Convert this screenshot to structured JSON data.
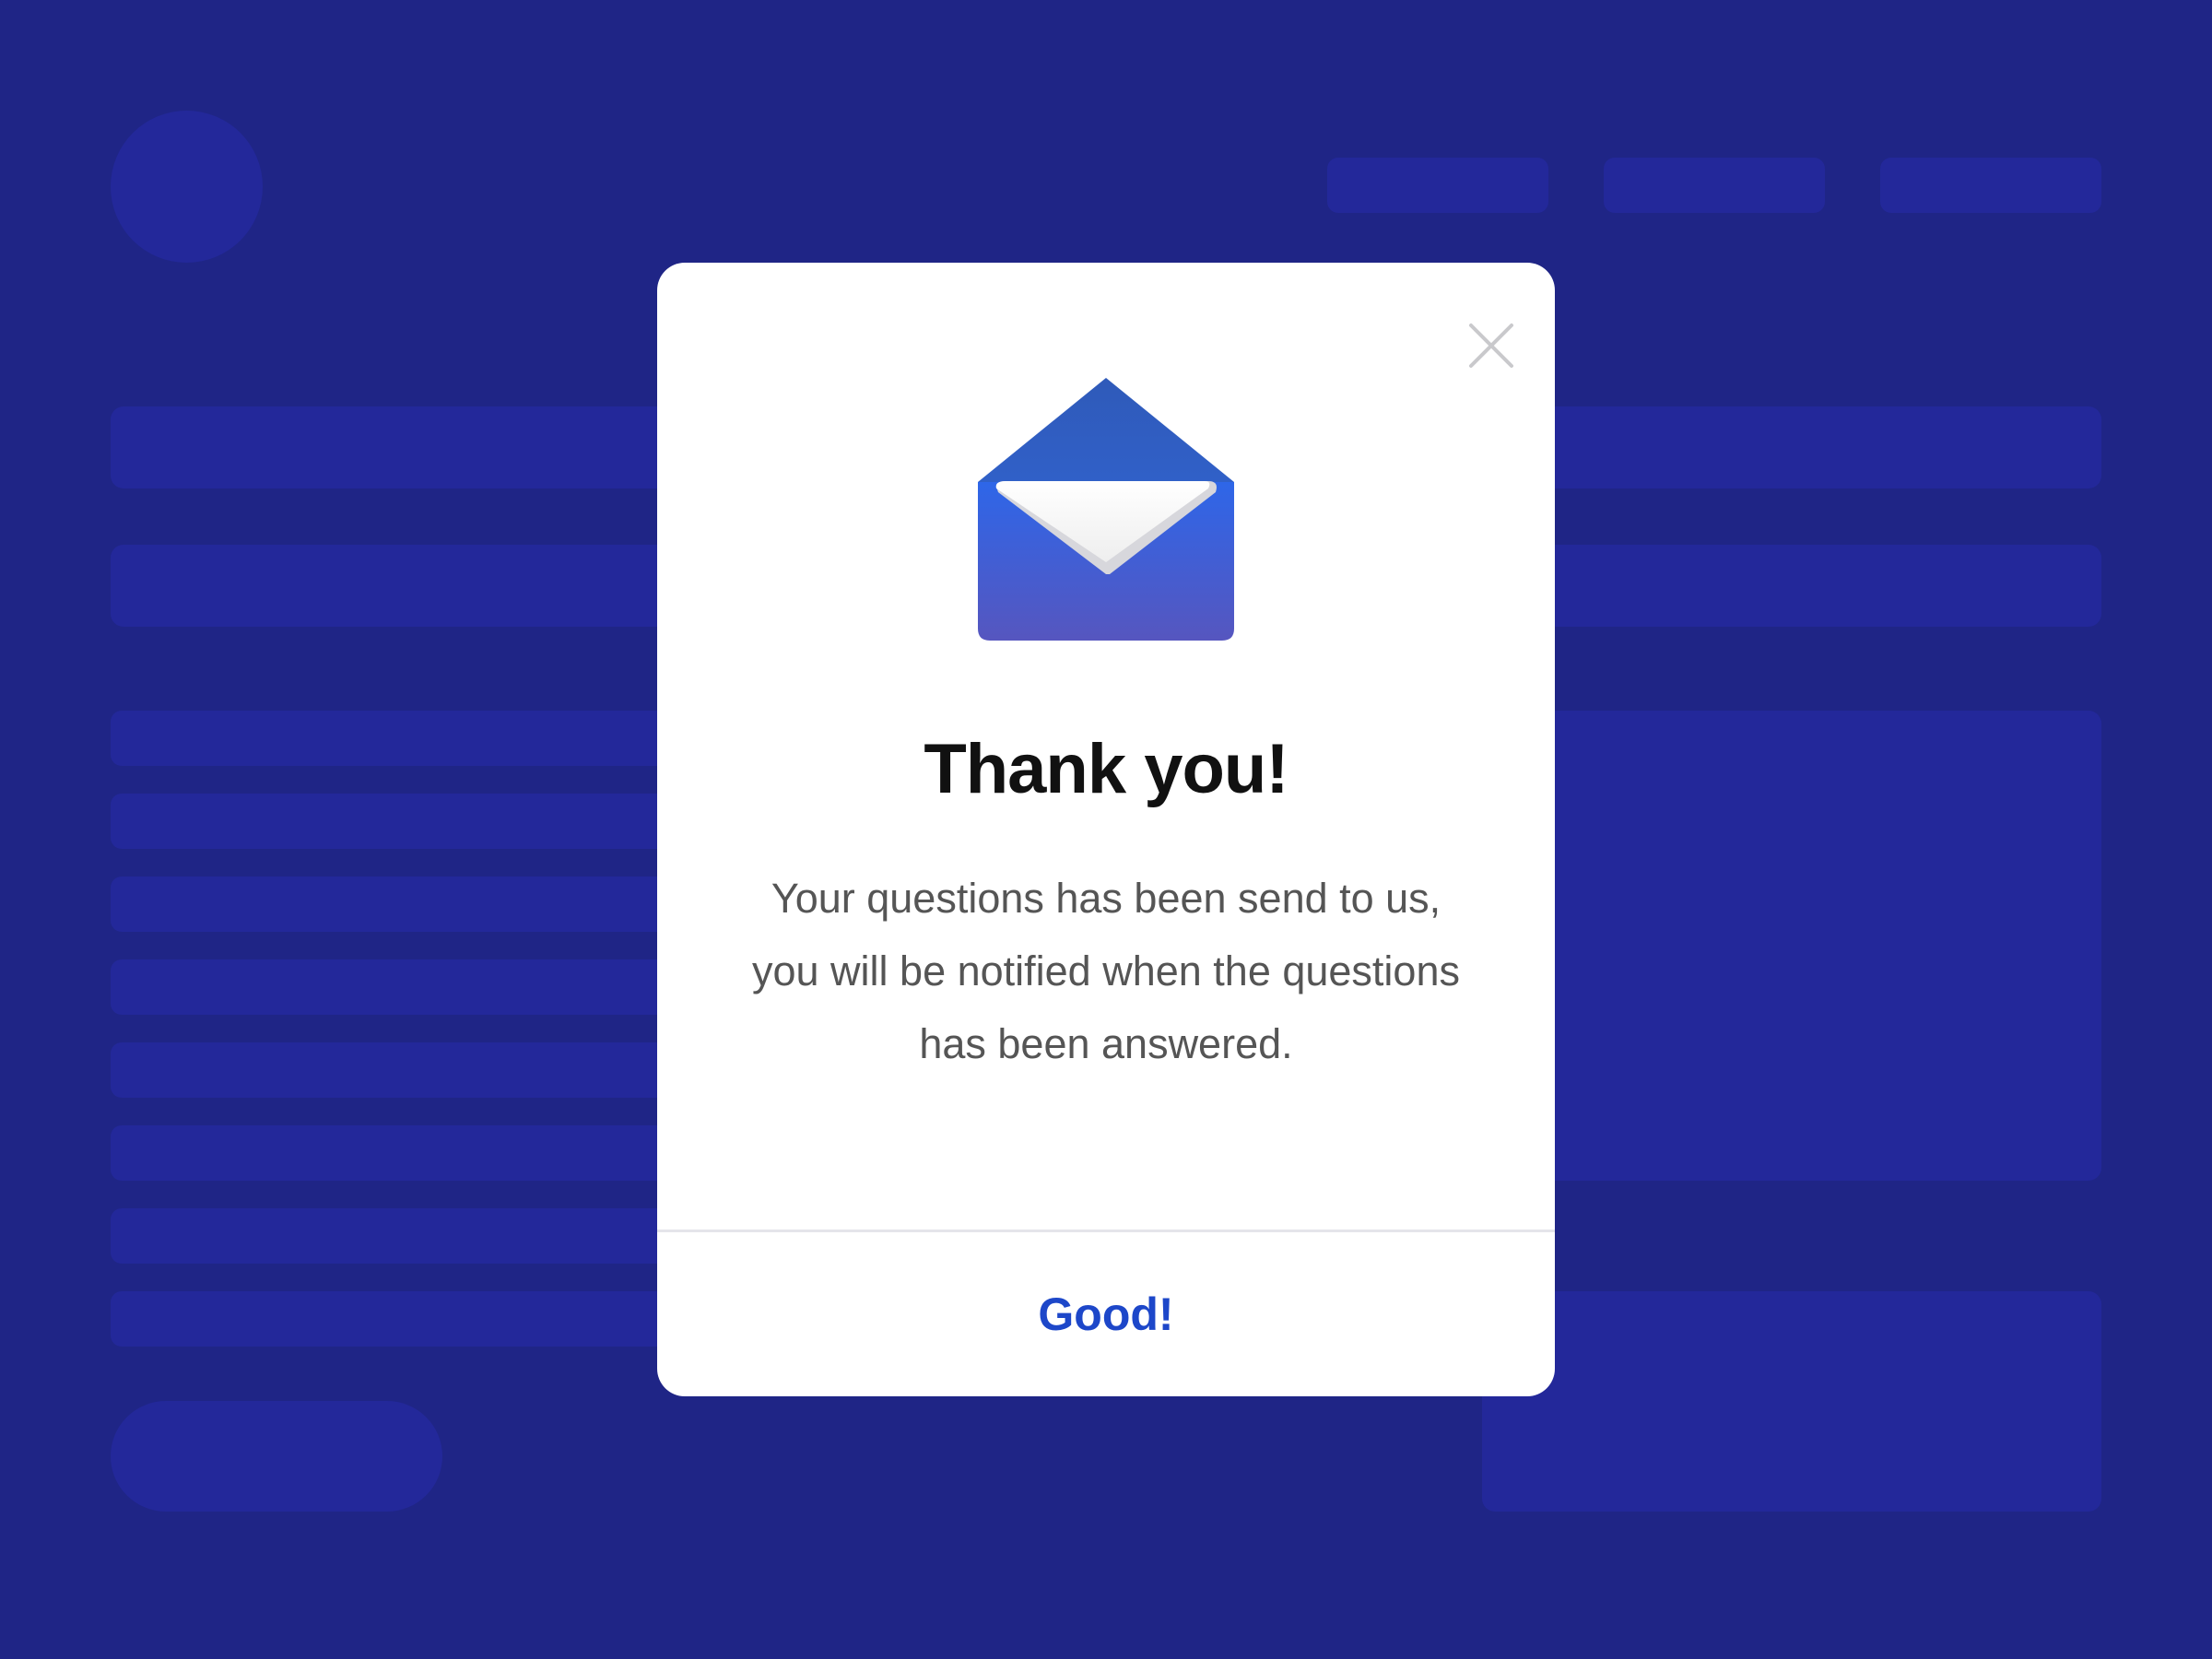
{
  "modal": {
    "title": "Thank you!",
    "message": "Your questions has been send to us, you will be notified when the questions has been answered.",
    "confirm_label": "Good!",
    "close_icon": "close-icon",
    "illustration_icon": "open-envelope-icon"
  },
  "colors": {
    "background": "#1f2586",
    "placeholder": "#23289a",
    "modal_background": "#ffffff",
    "title": "#111111",
    "body_text": "#555555",
    "accent": "#1d47c9",
    "envelope_top": "#2f58b4",
    "envelope_body_top": "#2e66e8",
    "envelope_body_bottom": "#5656bf"
  }
}
